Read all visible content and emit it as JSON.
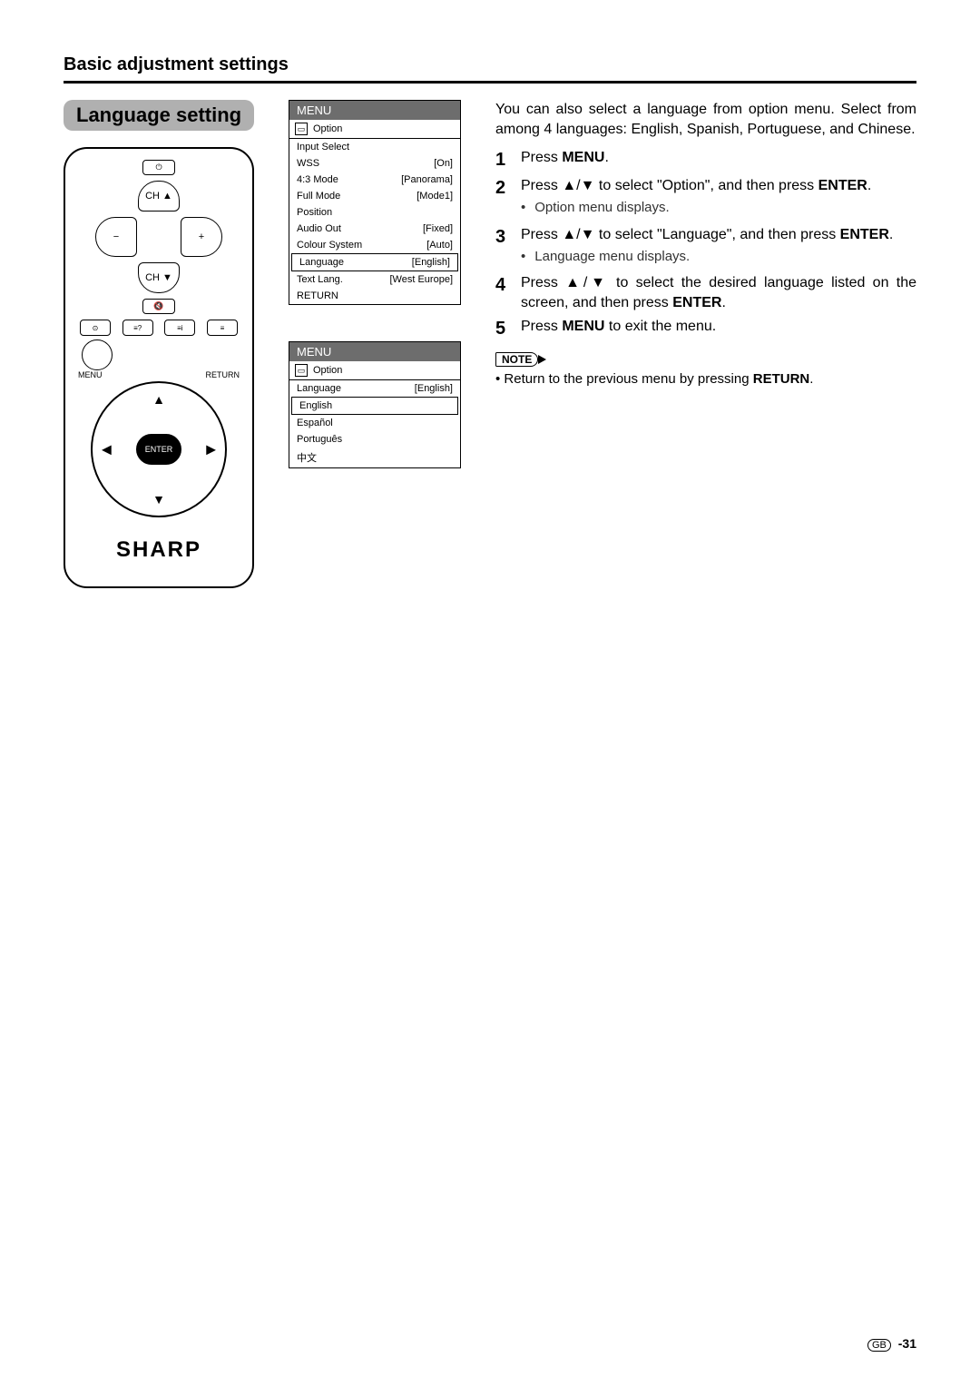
{
  "page": {
    "section_title": "Basic adjustment settings",
    "banner": "Language setting",
    "footer_region": "GB",
    "footer_page": "-31"
  },
  "remote": {
    "ch_up": "CH ▲",
    "ch_down": "CH ▼",
    "vol_minus": "−",
    "vol_plus": "+",
    "menu_label": "MENU",
    "return_label": "RETURN",
    "enter_label": "ENTER",
    "brand": "SHARP"
  },
  "menu1": {
    "title": "MENU",
    "subtitle": "Option",
    "rows": [
      {
        "label": "Input Select",
        "value": ""
      },
      {
        "label": "WSS",
        "value": "[On]"
      },
      {
        "label": "4:3 Mode",
        "value": "[Panorama]"
      },
      {
        "label": "Full Mode",
        "value": "[Mode1]"
      },
      {
        "label": "Position",
        "value": ""
      },
      {
        "label": "Audio Out",
        "value": "[Fixed]"
      },
      {
        "label": "Colour System",
        "value": "[Auto]"
      },
      {
        "label": "Language",
        "value": "[English]",
        "highlight": true
      },
      {
        "label": "Text Lang.",
        "value": "[West Europe]"
      },
      {
        "label": "RETURN",
        "value": ""
      }
    ]
  },
  "menu2": {
    "title": "MENU",
    "subtitle": "Option",
    "header": {
      "label": "Language",
      "value": "[English]"
    },
    "options": [
      "English",
      "Español",
      "Português",
      "中文"
    ],
    "highlight_index": 0
  },
  "right": {
    "intro": "You can also select a language from option menu. Select from among 4 languages: English, Spanish, Portuguese, and Chinese.",
    "steps": {
      "s1": {
        "num": "1",
        "pre": "Press ",
        "bold": "MENU",
        "post": "."
      },
      "s2": {
        "num": "2",
        "pre": "Press ▲/▼ to select \"Option\", and then press ",
        "bold": "ENTER",
        "post": ".",
        "bullet": "Option menu displays."
      },
      "s3": {
        "num": "3",
        "pre": "Press ▲/▼ to select \"Language\", and then press ",
        "bold": "ENTER",
        "post": ".",
        "bullet": "Language menu displays."
      },
      "s4": {
        "num": "4",
        "pre": "Press ▲/▼ to select the desired language listed on the screen, and then press ",
        "bold": "ENTER",
        "post": "."
      },
      "s5": {
        "num": "5",
        "pre": "Press ",
        "bold": "MENU",
        "post": " to exit the menu."
      }
    },
    "note_label": "NOTE",
    "note": {
      "pre": "Return to the previous menu by pressing ",
      "bold": "RETURN",
      "post": "."
    }
  }
}
